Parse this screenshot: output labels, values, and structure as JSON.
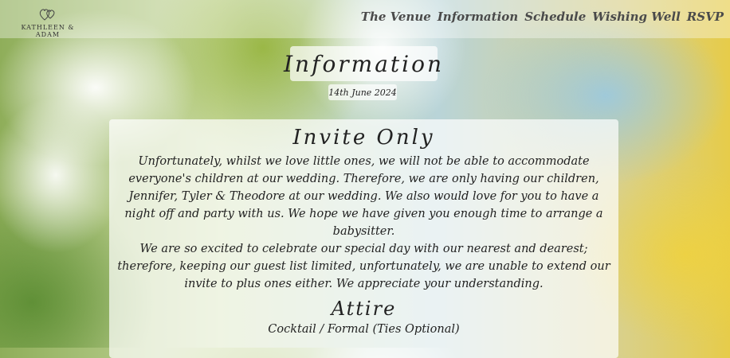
{
  "logo": {
    "text": "KATHLEEN & ADAM",
    "icon": "hearts-icon"
  },
  "nav": {
    "items": [
      {
        "label": "The Venue"
      },
      {
        "label": "Information"
      },
      {
        "label": "Schedule"
      },
      {
        "label": "Wishing Well"
      },
      {
        "label": "RSVP"
      }
    ]
  },
  "header": {
    "title": "Information",
    "date": "14th June 2024"
  },
  "invite": {
    "heading": "Invite Only",
    "paragraph1": "Unfortunately, whilst we love little ones, we will not be able to accommodate everyone's children at our wedding. Therefore, we are only having our children, Jennifer, Tyler & Theodore at our wedding. We also would love for you to have a night off and party with us. We hope we have given you enough time to arrange a babysitter.",
    "paragraph2": "We are so excited to celebrate our special day with our nearest and dearest; therefore, keeping our guest list limited, unfortunately, we are unable to extend our invite to plus ones either. We appreciate your understanding."
  },
  "attire": {
    "heading": "Attire",
    "text": "Cocktail / Formal (Ties Optional)"
  }
}
